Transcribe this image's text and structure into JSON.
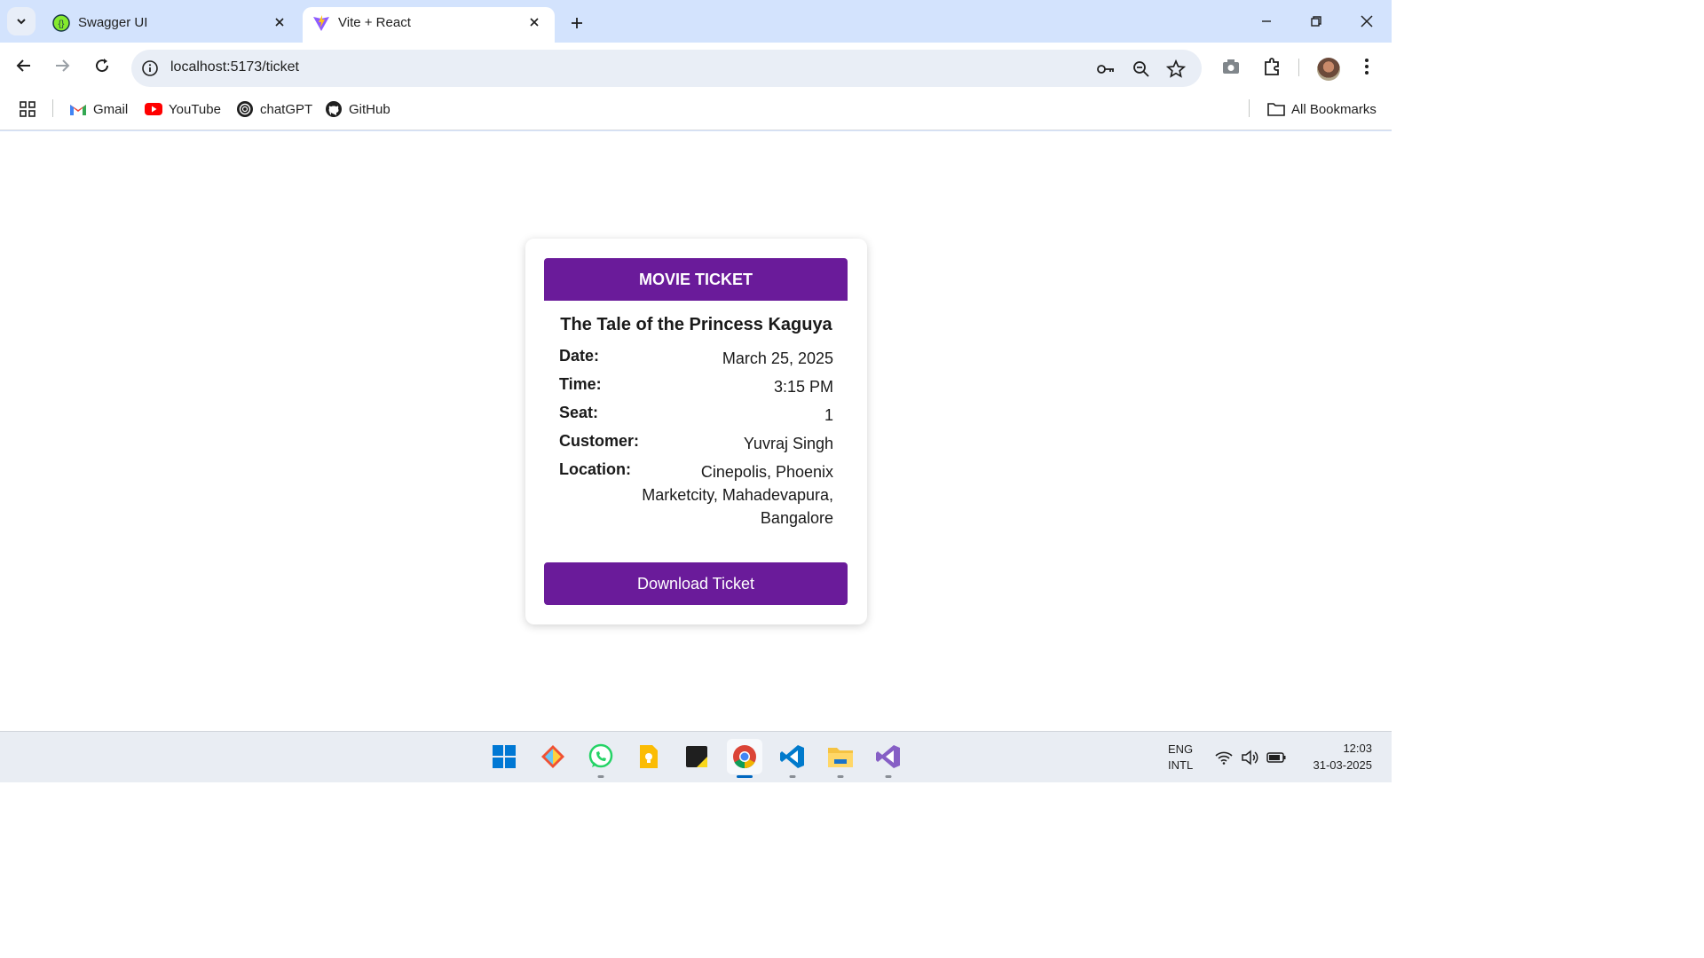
{
  "browser": {
    "tabs": [
      {
        "label": "Swagger UI",
        "active": false
      },
      {
        "label": "Vite + React",
        "active": true
      }
    ],
    "url": "localhost:5173/ticket",
    "bookmarks": [
      {
        "label": "Gmail"
      },
      {
        "label": "YouTube"
      },
      {
        "label": "chatGPT"
      },
      {
        "label": "GitHub"
      }
    ],
    "all_bookmarks_label": "All Bookmarks"
  },
  "ticket": {
    "header": "MOVIE TICKET",
    "movie_title": "The Tale of the Princess Kaguya",
    "fields": [
      {
        "label": "Date:",
        "value": "March 25, 2025"
      },
      {
        "label": "Time:",
        "value": "3:15 PM"
      },
      {
        "label": "Seat:",
        "value": "1"
      },
      {
        "label": "Customer:",
        "value": "Yuvraj Singh"
      },
      {
        "label": "Location:",
        "value_lines": [
          "Cinepolis, Phoenix",
          "Marketcity, Mahadevapura,",
          "Bangalore"
        ]
      }
    ],
    "download_label": "Download Ticket",
    "accent_color": "#6a1b9a"
  },
  "taskbar": {
    "language": "ENG",
    "layout": "INTL",
    "time": "12:03",
    "date": "31-03-2025",
    "apps": [
      "windows-start-icon",
      "git-icon",
      "whatsapp-icon",
      "keep-icon",
      "sticky-notes-icon",
      "chrome-icon",
      "vscode-icon",
      "file-explorer-icon",
      "visual-studio-icon"
    ]
  }
}
